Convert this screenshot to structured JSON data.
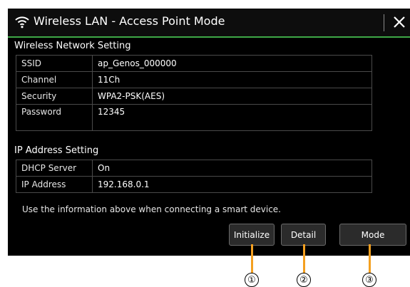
{
  "window": {
    "title": "Wireless LAN - Access Point Mode",
    "icon": "wifi-icon",
    "close_icon": "close-icon"
  },
  "wireless_section": {
    "label": "Wireless Network Setting",
    "rows": [
      {
        "key": "SSID",
        "value": "ap_Genos_000000"
      },
      {
        "key": "Channel",
        "value": "11Ch"
      },
      {
        "key": "Security",
        "value": "WPA2-PSK(AES)"
      },
      {
        "key": "Password",
        "value": "12345"
      }
    ]
  },
  "ip_section": {
    "label": "IP Address Setting",
    "rows": [
      {
        "key": "DHCP Server",
        "value": "On"
      },
      {
        "key": "IP Address",
        "value": "192.168.0.1"
      }
    ]
  },
  "info_text": "Use the information above when connecting a smart device.",
  "buttons": {
    "initialize": "Initialize",
    "detail": "Detail",
    "mode": "Mode"
  },
  "callouts": [
    "①",
    "②",
    "③"
  ],
  "colors": {
    "accent_line": "#3fa847",
    "callout_line": "#f4a020",
    "screen_bg": "#000000"
  }
}
